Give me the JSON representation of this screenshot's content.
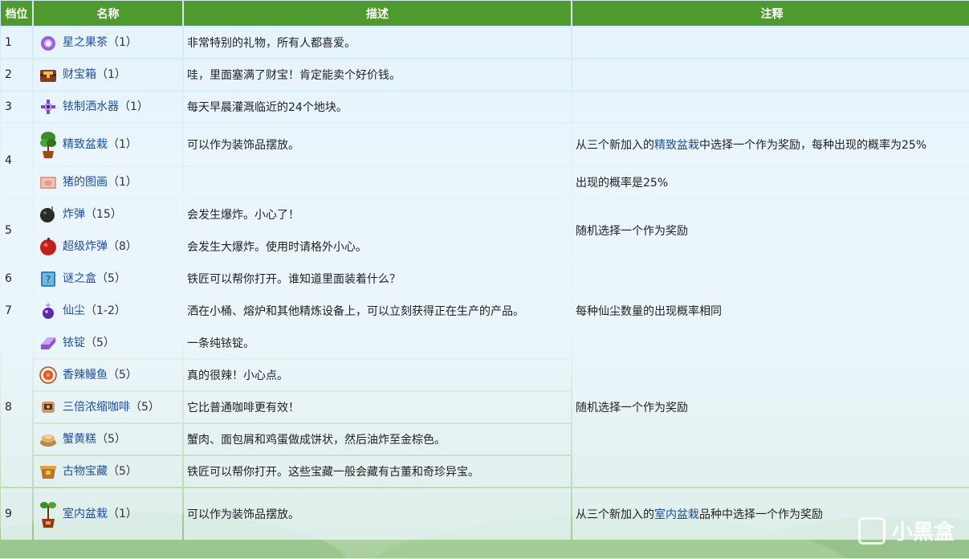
{
  "headers": [
    "档位",
    "名称",
    "描述",
    "注释"
  ],
  "items": {
    "r1": {
      "tier": "1",
      "name": "星之果茶",
      "qty": "（1）",
      "desc": "非常特别的礼物，所有人都喜爱。"
    },
    "r2": {
      "tier": "2",
      "name": "财宝箱",
      "qty": "（1）",
      "desc": "哇，里面塞满了财宝！肯定能卖个好价钱。"
    },
    "r3": {
      "tier": "3",
      "name": "铱制洒水器",
      "qty": "（1）",
      "desc": "每天早晨灌溉临近的24个地块。"
    },
    "r4a": {
      "tier": "4",
      "name": "精致盆栽",
      "qty": "（1）",
      "desc": "可以作为装饰品摆放。"
    },
    "r4b": {
      "name": "猪的图画",
      "qty": "（1）",
      "desc": ""
    },
    "r5a": {
      "tier": "5",
      "name": "炸弹",
      "qty": "（15）",
      "desc": "会发生爆炸。小心了！"
    },
    "r5b": {
      "name": "超级炸弹",
      "qty": "（8）",
      "desc": "会发生大爆炸。使用时请格外小心。"
    },
    "r6": {
      "tier": "6",
      "name": "谜之盒",
      "qty": "（5）",
      "desc": "铁匠可以帮你打开。谁知道里面装着什么？"
    },
    "r7": {
      "tier": "7",
      "name": "仙尘",
      "qty": "（1-2）",
      "desc": "洒在小桶、熔炉和其他精炼设备上，可以立刻获得正在生产的产品。"
    },
    "r8a": {
      "tier": "8",
      "name": "铱锭",
      "qty": "（5）",
      "desc": "一条纯铱锭。"
    },
    "r8b": {
      "name": "香辣鳗鱼",
      "qty": "（5）",
      "desc": "真的很辣！小心点。"
    },
    "r8c": {
      "name": "三倍浓缩咖啡",
      "qty": "（5）",
      "desc": "它比普通咖啡更有效！"
    },
    "r8d": {
      "name": "蟹黄糕",
      "qty": "（5）",
      "desc": "蟹肉、面包屑和鸡蛋做成饼状，然后油炸至金棕色。"
    },
    "r8e": {
      "name": "古物宝藏",
      "qty": "（5）",
      "desc": "铁匠可以帮你打开。这些宝藏一般会藏有古董和奇珍异宝。"
    },
    "r9": {
      "tier": "9",
      "name": "室内盆栽",
      "qty": "（1）",
      "desc": "可以作为装饰品摆放。"
    }
  },
  "notes": {
    "n4a_pre": "从三个新加入的",
    "n4a_link": "精致盆栽",
    "n4a_post": "中选择一个作为奖励，每种出现的概率为25%",
    "n4b": "出现的概率是25%",
    "n5": "随机选择一个作为奖励",
    "n7": "每种仙尘数量的出现概率相同",
    "n8": "随机选择一个作为奖励",
    "n9_pre": "从三个新加入的",
    "n9_link": "室内盆栽",
    "n9_post": "品种中选择一个作为奖励"
  },
  "watermark": "小黑盒",
  "icons": [
    "star-tea-icon",
    "treasure-chest-icon",
    "iridium-sprinkler-icon",
    "fancy-bonsai-icon",
    "pig-painting-icon",
    "bomb-icon",
    "mega-bomb-icon",
    "mystery-box-icon",
    "fairy-dust-icon",
    "iridium-bar-icon",
    "spicy-eel-icon",
    "triple-espresso-icon",
    "crab-cake-icon",
    "artifact-trove-icon",
    "indoor-bonsai-icon"
  ]
}
